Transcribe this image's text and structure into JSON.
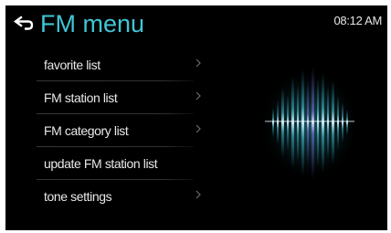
{
  "header": {
    "title": "FM menu",
    "time": "08:12 AM",
    "back_icon": "back-arrow-icon",
    "accent_color": "#3fc6d4"
  },
  "menu": {
    "items": [
      {
        "label": "favorite list",
        "has_arrow": true
      },
      {
        "label": "FM station list",
        "has_arrow": true
      },
      {
        "label": "FM category list",
        "has_arrow": true
      },
      {
        "label": "update FM station list",
        "has_arrow": false
      },
      {
        "label": "tone settings",
        "has_arrow": true
      }
    ],
    "arrow_icon": "chevron-right-icon"
  },
  "visual": {
    "icon": "sound-wave-visualizer-icon"
  }
}
